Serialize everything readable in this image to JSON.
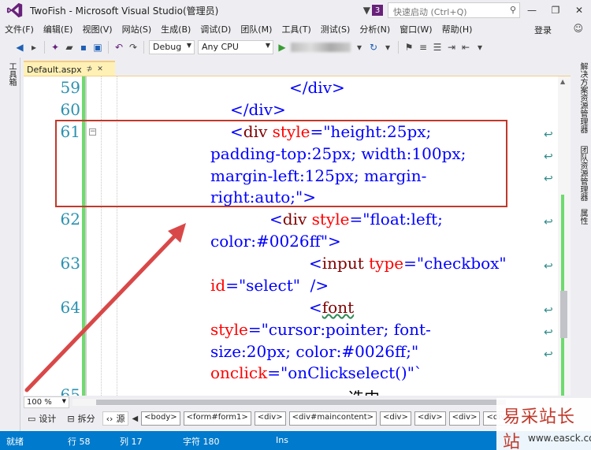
{
  "window": {
    "title": "TwoFish - Microsoft Visual Studio(管理员)",
    "notification_count": "3",
    "quick_launch_placeholder": "快速启动 (Ctrl+Q)",
    "minimize": "—",
    "restore": "❐",
    "close": "✕"
  },
  "menu": {
    "items": [
      "文件(F)",
      "编辑(E)",
      "视图(V)",
      "网站(S)",
      "生成(B)",
      "调试(D)",
      "团队(M)",
      "工具(T)",
      "测试(S)",
      "分析(N)",
      "窗口(W)",
      "帮助(H)"
    ],
    "login": "登录"
  },
  "toolbar": {
    "config": "Debug",
    "platform": "Any CPU"
  },
  "left_panel": {
    "toolbox": "工具箱"
  },
  "right_panel": {
    "solution_explorer": "解决方案资源管理器",
    "team_explorer": "团队资源管理器",
    "properties": "属性"
  },
  "tab": {
    "filename": "Default.aspx",
    "pin": "⊅",
    "close": "✕"
  },
  "editor": {
    "line_numbers": [
      "59",
      "60",
      "61",
      "62",
      "63",
      "64",
      "65"
    ],
    "lines": [
      {
        "tag": "</div>"
      },
      {
        "tag": "</div>"
      },
      {
        "open": "<",
        "name": "div",
        "attr": "style",
        "eq": "=",
        "val": "\"height:25px;"
      },
      {
        "val": "padding-top:25px; width:100px;"
      },
      {
        "val": "margin-left:125px; margin-"
      },
      {
        "val": "right:auto;\"",
        "close": ">"
      },
      {
        "open": "<",
        "name": "div",
        "attr": "style",
        "eq": "=",
        "val": "\"float:left;"
      },
      {
        "val": "color:#0026ff\"",
        "close": ">"
      },
      {
        "open": "<",
        "name": "input",
        "attr": "type",
        "eq": "=",
        "val": "\"checkbox\""
      },
      {
        "attr": "id",
        "eq": "=",
        "val": "\"select\"",
        "close": "  />"
      },
      {
        "open": "<",
        "name": "font"
      },
      {
        "attr": "style",
        "eq": "=",
        "val": "\"cursor:pointer; font-"
      },
      {
        "val": "size:20px; color:#0026ff;\""
      },
      {
        "attr": "onclick",
        "eq": "=",
        "val": "\"onClickselect()\"`"
      },
      {
        "plain": "选中"
      }
    ]
  },
  "bottom": {
    "zoom": "100 %",
    "design": "设计",
    "split": "拆分",
    "source": "源",
    "breadcrumbs": [
      "<body>",
      "<form#form1>",
      "<div>",
      "<div#maincontent>",
      "<div>",
      "<div>",
      "<div>",
      "<div>"
    ]
  },
  "status": {
    "ready": "就绪",
    "line": "行 58",
    "col": "列 17",
    "char": "字符 180",
    "mode": "Ins"
  },
  "watermark": {
    "title": "易采站长站",
    "url": "www.easck.com"
  },
  "colors": {
    "accent": "#68217a",
    "statusbar": "#007acc",
    "highlight": "#c0392b"
  }
}
